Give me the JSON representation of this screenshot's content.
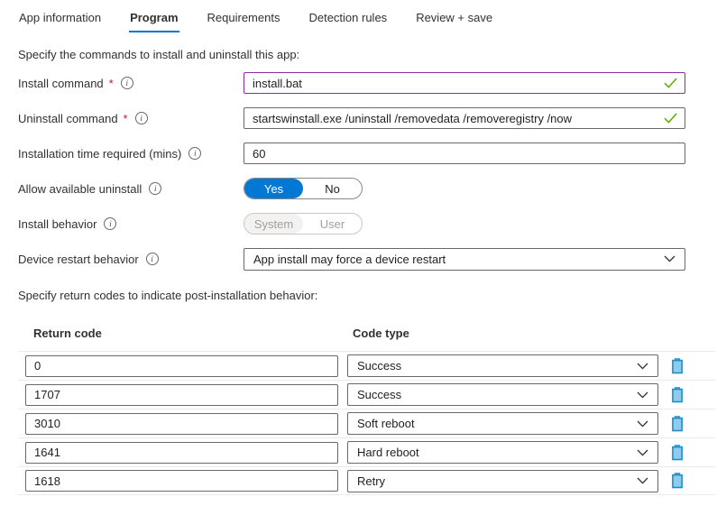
{
  "colors": {
    "accent": "#0078d4",
    "modified_border": "#8a2da2",
    "valid_green": "#5db300",
    "required_red": "#a4262c",
    "delete_blue": "#1e8fcc",
    "disabled_gray": "#a19f9d",
    "separator": "#edebe9"
  },
  "required_marker": "*",
  "icons": {
    "info_glyph": "i"
  },
  "tabs": [
    {
      "label": "App information",
      "active": false
    },
    {
      "label": "Program",
      "active": true
    },
    {
      "label": "Requirements",
      "active": false
    },
    {
      "label": "Detection rules",
      "active": false
    },
    {
      "label": "Review + save",
      "active": false
    }
  ],
  "intro_commands": "Specify the commands to install and uninstall this app:",
  "fields": {
    "install_command": {
      "label": "Install command",
      "value": "install.bat",
      "valid": true
    },
    "uninstall_command": {
      "label": "Uninstall command",
      "value": "startswinstall.exe /uninstall /removedata /removeregistry /now",
      "valid": true
    },
    "install_time": {
      "label": "Installation time required (mins)",
      "value": "60"
    },
    "allow_available_uninstall": {
      "label": "Allow available uninstall",
      "options": [
        "Yes",
        "No"
      ],
      "selected": "Yes"
    },
    "install_behavior": {
      "label": "Install behavior",
      "options": [
        "System",
        "User"
      ],
      "selected": "System",
      "disabled": true
    },
    "device_restart_behavior": {
      "label": "Device restart behavior",
      "value": "App install may force a device restart"
    }
  },
  "intro_return_codes": "Specify return codes to indicate post-installation behavior:",
  "return_codes": {
    "headers": {
      "code": "Return code",
      "type": "Code type"
    },
    "rows": [
      {
        "code": "0",
        "type": "Success"
      },
      {
        "code": "1707",
        "type": "Success"
      },
      {
        "code": "3010",
        "type": "Soft reboot"
      },
      {
        "code": "1641",
        "type": "Hard reboot"
      },
      {
        "code": "1618",
        "type": "Retry"
      }
    ]
  }
}
